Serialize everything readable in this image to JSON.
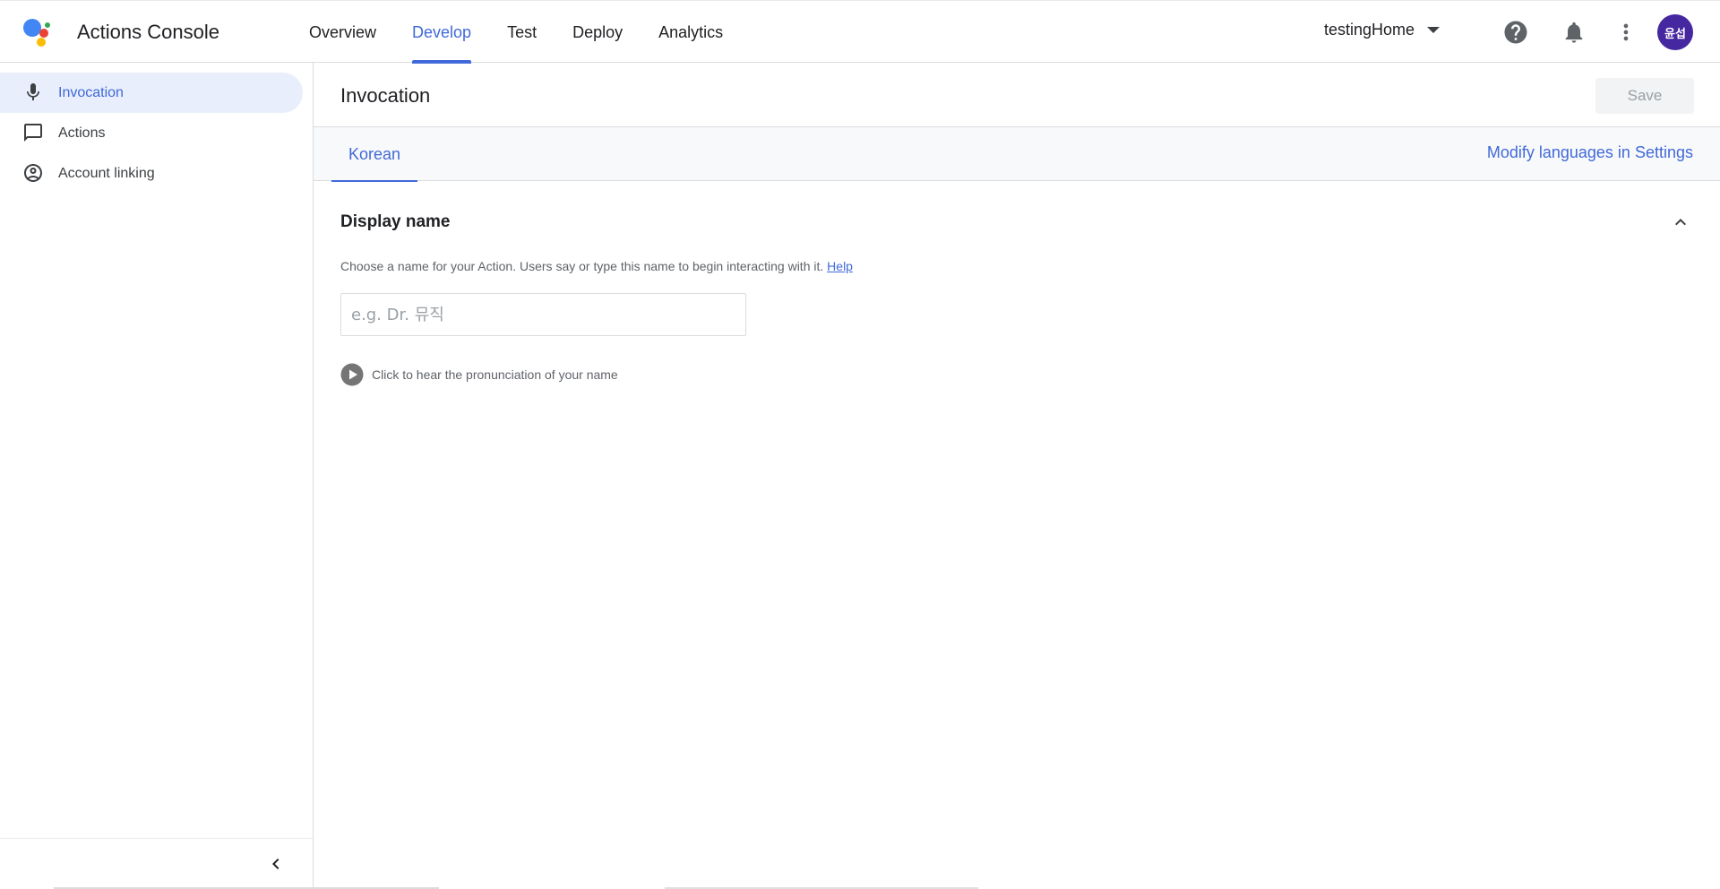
{
  "header": {
    "app_title": "Actions Console",
    "tabs": [
      {
        "label": "Overview"
      },
      {
        "label": "Develop",
        "active": true
      },
      {
        "label": "Test"
      },
      {
        "label": "Deploy"
      },
      {
        "label": "Analytics"
      }
    ],
    "project": "testingHome",
    "avatar_text": "윤섭",
    "icons": [
      "help-icon",
      "notifications-bell-icon",
      "more-vert-icon"
    ]
  },
  "sidebar": {
    "items": [
      {
        "label": "Invocation",
        "icon": "mic-icon",
        "active": true
      },
      {
        "label": "Actions",
        "icon": "chat-bubble-icon"
      },
      {
        "label": "Account linking",
        "icon": "account-circle-icon"
      }
    ],
    "collapse_icon": "chevron-left-icon"
  },
  "main": {
    "page_title": "Invocation",
    "save_label": "Save",
    "language_tab": "Korean",
    "modify_languages": "Modify languages in Settings",
    "section_title": "Display name",
    "description": "Choose a name for your Action. Users say or type this name to begin interacting with it.",
    "help_link": "Help",
    "input_value": "",
    "input_placeholder": "e.g. Dr. 뮤직",
    "pronunciation_text": "Click to hear the pronunciation of your name"
  },
  "colors": {
    "accent": "#4169d9",
    "active_nav_bg": "#e8eefb",
    "avatar_bg": "#4527a0"
  }
}
